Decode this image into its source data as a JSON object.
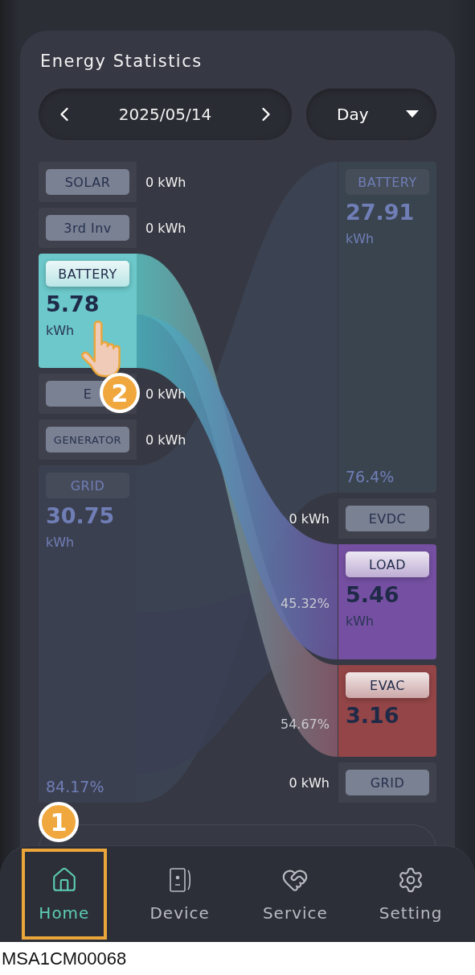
{
  "header": {
    "title": "Energy Statistics"
  },
  "date_picker": {
    "date": "2025/05/14"
  },
  "period_select": {
    "value": "Day"
  },
  "sources": [
    {
      "kind": "chip",
      "label": "SOLAR",
      "reading": "0 kWh"
    },
    {
      "kind": "chip",
      "label": "3rd Inv",
      "reading": "0 kWh"
    },
    {
      "kind": "node",
      "label": "BATTERY",
      "value": "5.78",
      "unit": "kWh",
      "highlighted": true,
      "color": "#6cc8ca"
    },
    {
      "kind": "chip",
      "label": "E",
      "reading": "0 kWh"
    },
    {
      "kind": "chip",
      "label": "GENERATOR",
      "reading": "0 kWh"
    },
    {
      "kind": "node",
      "label": "GRID",
      "value": "30.75",
      "unit": "kWh",
      "reading": "84.17%",
      "highlighted": false,
      "color": "#3c4152"
    }
  ],
  "targets": [
    {
      "kind": "node",
      "label": "BATTERY",
      "value": "27.91",
      "unit": "kWh",
      "reading": "76.4%",
      "highlighted": false,
      "color": "#3a4550"
    },
    {
      "kind": "chip",
      "label": "EVDC",
      "reading": "0 kWh"
    },
    {
      "kind": "node",
      "label": "LOAD",
      "value": "5.46",
      "unit": "kWh",
      "reading": "45.32%",
      "highlighted": true,
      "color": "#7550a2"
    },
    {
      "kind": "node",
      "label": "EVAC",
      "value": "3.16",
      "reading": "54.67%",
      "highlighted": true,
      "color": "#934547"
    },
    {
      "kind": "chip",
      "label": "GRID",
      "reading": "0 kWh"
    }
  ],
  "tabs": [
    {
      "label": "Home",
      "selected": true,
      "highlighted": true
    },
    {
      "label": "Device",
      "selected": false,
      "highlighted": false
    },
    {
      "label": "Service",
      "selected": false,
      "highlighted": false
    },
    {
      "label": "Setting",
      "selected": false,
      "highlighted": false
    }
  ],
  "markers": [
    {
      "text": "1"
    },
    {
      "text": "2"
    }
  ],
  "caption": "MSA1CM00068"
}
